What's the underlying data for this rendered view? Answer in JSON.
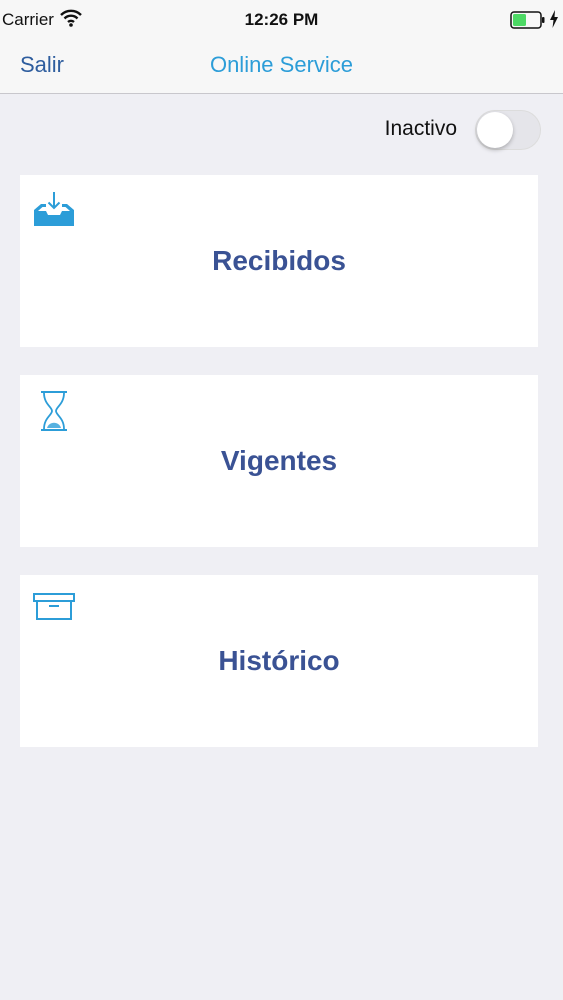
{
  "status_bar": {
    "carrier": "Carrier",
    "time": "12:26 PM",
    "battery_color": "#4cd964"
  },
  "nav": {
    "back_label": "Salir",
    "title": "Online Service",
    "back_color": "#2e5d9e",
    "title_color": "#2c9dd8"
  },
  "status_toggle": {
    "label": "Inactivo",
    "on": false
  },
  "cards": [
    {
      "label": "Recibidos",
      "icon": "inbox-download-icon"
    },
    {
      "label": "Vigentes",
      "icon": "hourglass-icon"
    },
    {
      "label": "Histórico",
      "icon": "archive-box-icon"
    }
  ],
  "colors": {
    "accent_icon": "#2c9dd8",
    "card_text": "#3a5294",
    "background": "#efeff4"
  }
}
